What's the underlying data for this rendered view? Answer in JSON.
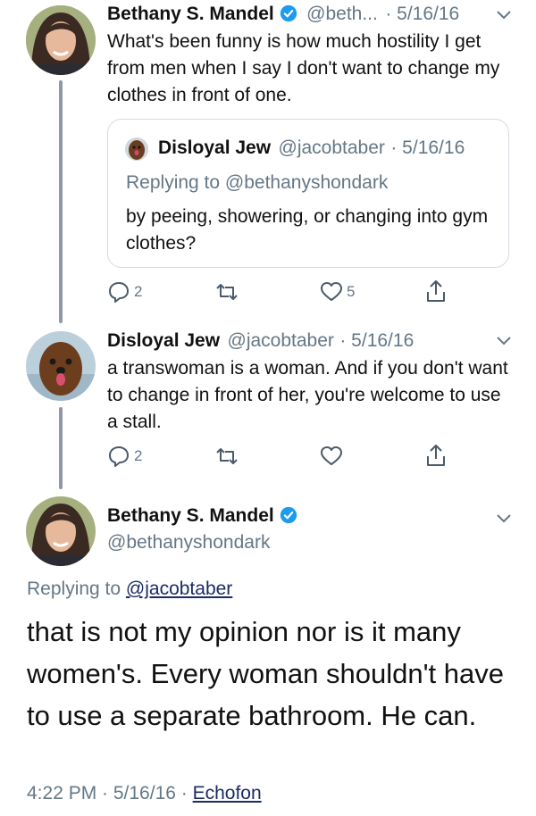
{
  "tweet1": {
    "name": "Bethany S. Mandel",
    "handle": "@beth...",
    "date": "· 5/16/16",
    "text": "What's been funny is how much hostility I get from men when I say I don't want to change my clothes in front of one.",
    "quoted": {
      "name": "Disloyal Jew",
      "handle": "@jacobtaber",
      "date": "· 5/16/16",
      "replying_to": "Replying to @bethanyshondark",
      "text": "by peeing, showering, or changing into gym clothes?"
    },
    "reply_count": "2",
    "like_count": "5"
  },
  "tweet2": {
    "name": "Disloyal Jew",
    "handle": "@jacobtaber",
    "date": "· 5/16/16",
    "text": "a transwoman is a woman.  And if you don't want to change in front of her, you're welcome to use a stall.",
    "reply_count": "2"
  },
  "main": {
    "name": "Bethany S. Mandel",
    "handle": "@bethanyshondark",
    "replying_prefix": "Replying to ",
    "replying_handle": "@jacobtaber",
    "text": "that is not my opinion nor is it many women's. Every woman shouldn't have to use a separate bathroom. He can.",
    "time": "4:22 PM · 5/16/16 · ",
    "source": "Echofon"
  },
  "colors": {
    "meta_gray": "#657786",
    "link": "#1b2b63",
    "verified": "#1d9bf0",
    "thread_line": "#8f98a3"
  },
  "icons": [
    "reply-icon",
    "retweet-icon",
    "like-icon",
    "share-icon",
    "chevron-down-icon",
    "verified-badge-icon"
  ]
}
